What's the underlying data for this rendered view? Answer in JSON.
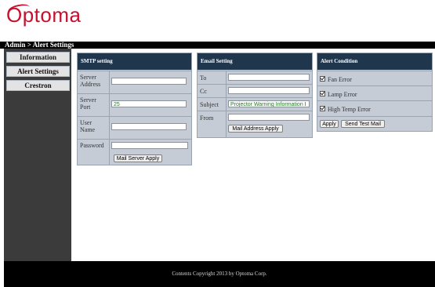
{
  "brand": {
    "name": "Optoma",
    "color": "#c8102e"
  },
  "breadcrumb": "Admin > Alert Settings",
  "sidebar": {
    "items": [
      {
        "label": "Information"
      },
      {
        "label": "Alert Settings"
      },
      {
        "label": "Crestron"
      }
    ]
  },
  "smtp": {
    "title": "SMTP setting",
    "server_address_label": "Server Address",
    "server_address_value": "",
    "server_port_label": "Server Port",
    "server_port_value": "25",
    "user_name_label": "User Name",
    "user_name_value": "",
    "password_label": "Password",
    "password_value": "",
    "apply_label": "Mail Server Apply"
  },
  "email": {
    "title": "Email Setting",
    "to_label": "To",
    "to_value": "",
    "cc_label": "Cc",
    "cc_value": "",
    "subject_label": "Subject",
    "subject_value": "Projector Warning Information Ⅰ",
    "from_label": "From",
    "from_value": "",
    "apply_label": "Mail Address Apply"
  },
  "alert": {
    "title": "Alert Condition",
    "items": [
      {
        "label": "Fan Error",
        "checked": true
      },
      {
        "label": "Lamp Error",
        "checked": true
      },
      {
        "label": "High Temp Error",
        "checked": true
      }
    ],
    "apply_label": "Apply",
    "test_label": "Send Test Mail"
  },
  "footer": {
    "text": "Contents Copyright 2013 by Optoma Corp."
  },
  "colors": {
    "header": "#20364d",
    "panel": "#c5ccd6",
    "sidebar": "#3b3b3b"
  }
}
